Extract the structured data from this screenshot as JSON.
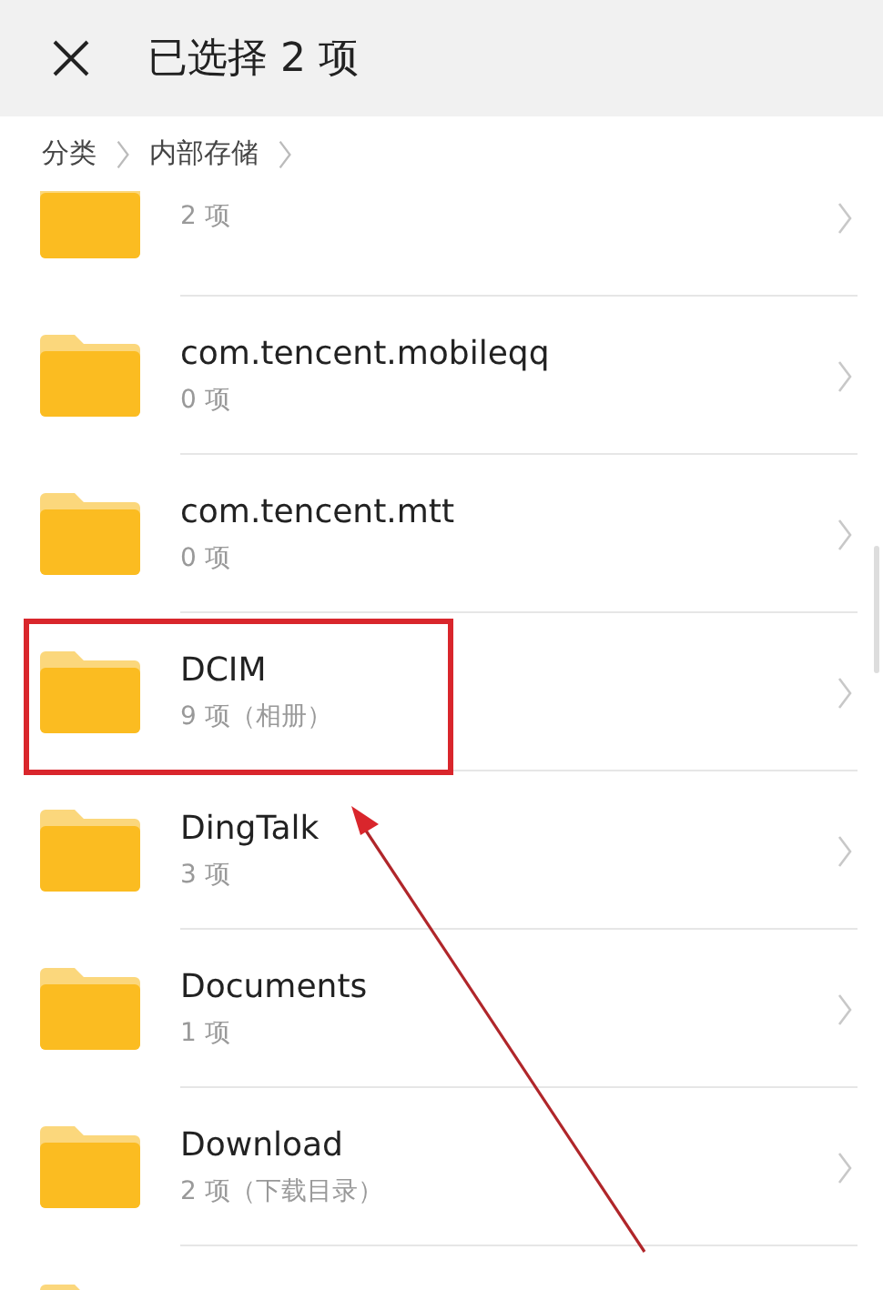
{
  "header": {
    "title": "已选择 2 项"
  },
  "breadcrumb": [
    "分类",
    "内部存储"
  ],
  "folders": [
    {
      "count": "2 项",
      "highlighted": false
    },
    {
      "name": "com.tencent.mobileqq",
      "count": "0 项",
      "highlighted": false
    },
    {
      "name": "com.tencent.mtt",
      "count": "0 项",
      "highlighted": false
    },
    {
      "name": "DCIM",
      "count": "9 项（相册）",
      "highlighted": true
    },
    {
      "name": "DingTalk",
      "count": "3 项",
      "highlighted": false
    },
    {
      "name": "Documents",
      "count": "1 项",
      "highlighted": false
    },
    {
      "name": "Download",
      "count": "2 项（下载目录）",
      "highlighted": false
    },
    {
      "highlighted": false
    }
  ]
}
